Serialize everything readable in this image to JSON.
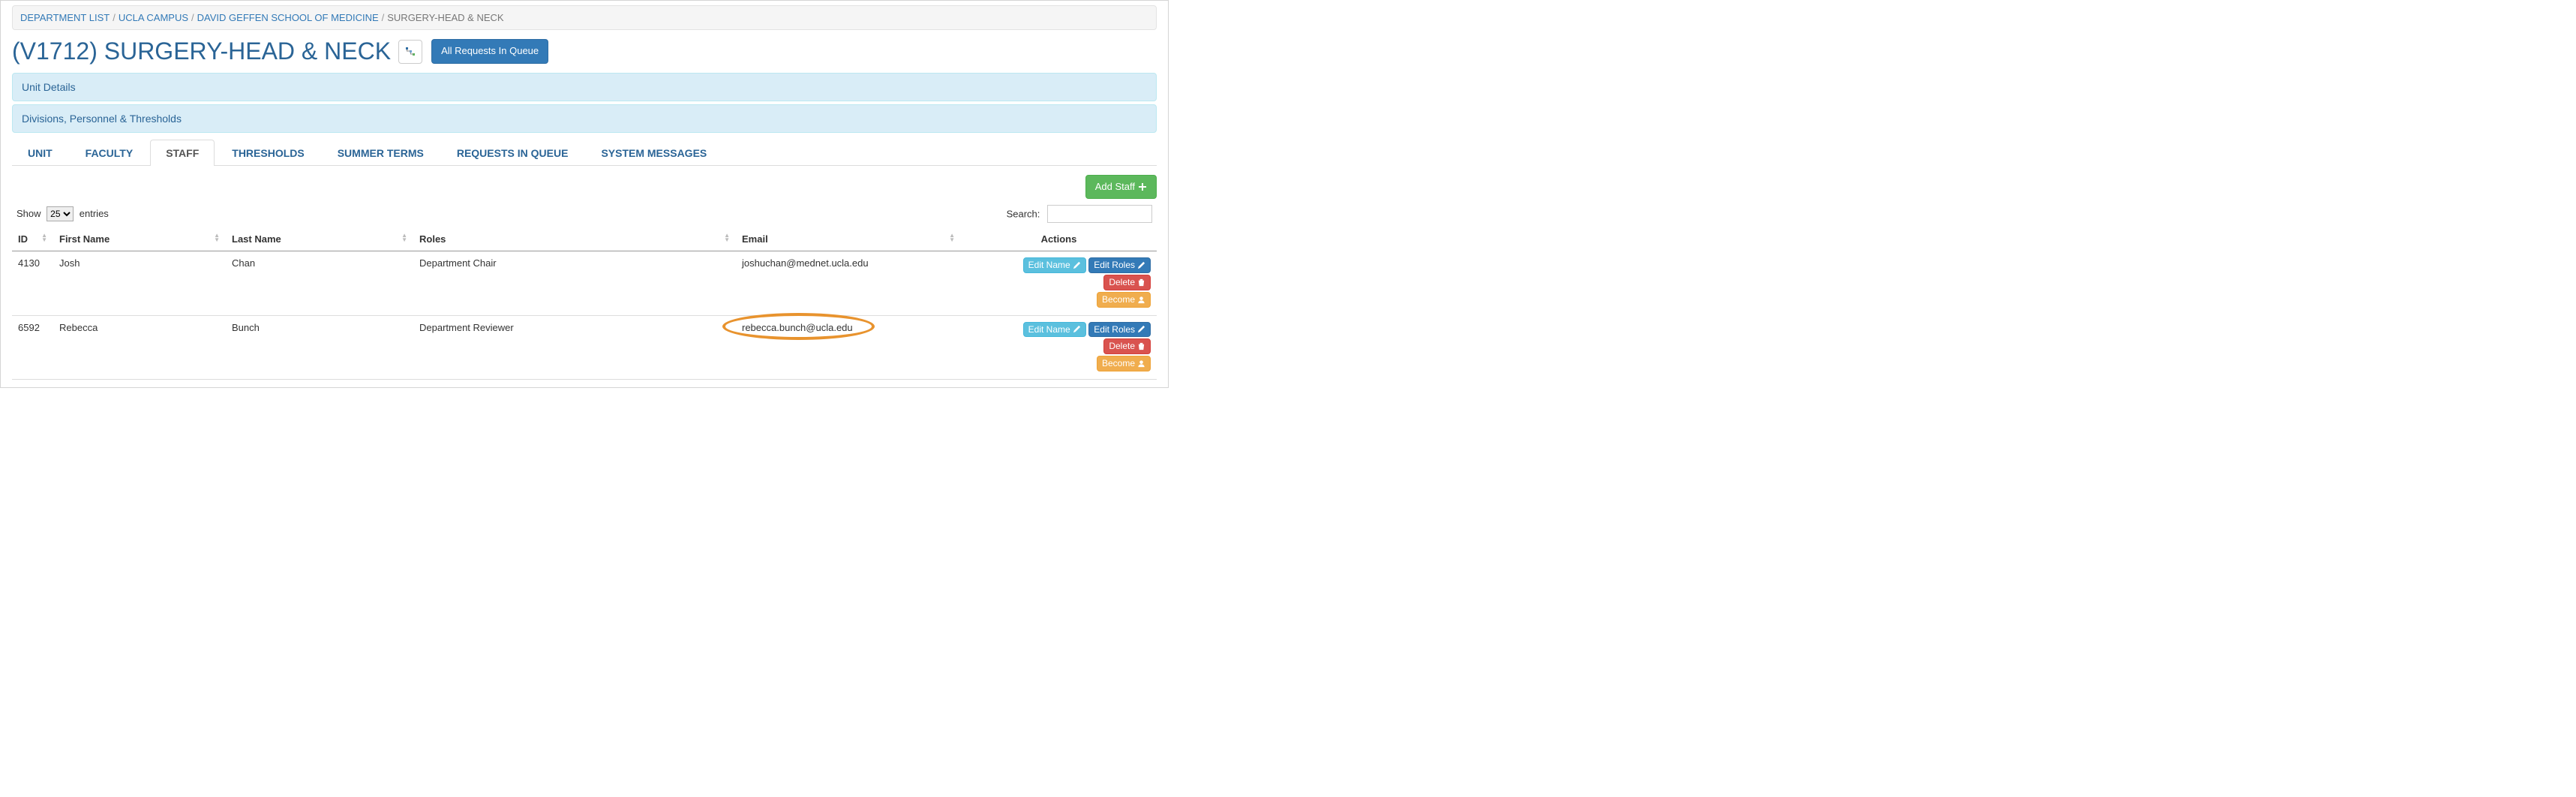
{
  "breadcrumb": {
    "items": [
      {
        "label": "DEPARTMENT LIST"
      },
      {
        "label": "UCLA CAMPUS"
      },
      {
        "label": "DAVID GEFFEN SCHOOL OF MEDICINE"
      }
    ],
    "current": "SURGERY-HEAD & NECK"
  },
  "title": "(V1712) SURGERY-HEAD & NECK",
  "all_requests_label": "All Requests In Queue",
  "panels": {
    "unit_details": "Unit Details",
    "divisions": "Divisions, Personnel & Thresholds"
  },
  "tabs": [
    {
      "label": "UNIT"
    },
    {
      "label": "FACULTY"
    },
    {
      "label": "STAFF",
      "active": true
    },
    {
      "label": "THRESHOLDS"
    },
    {
      "label": "SUMMER TERMS"
    },
    {
      "label": "REQUESTS IN QUEUE"
    },
    {
      "label": "SYSTEM MESSAGES"
    }
  ],
  "add_staff_label": "Add Staff",
  "length_menu": {
    "prefix": "Show",
    "suffix": "entries",
    "options": [
      "25"
    ]
  },
  "search_label": "Search:",
  "columns": {
    "id": "ID",
    "first_name": "First Name",
    "last_name": "Last Name",
    "roles": "Roles",
    "email": "Email",
    "actions": "Actions"
  },
  "rows": [
    {
      "id": "4130",
      "first_name": "Josh",
      "last_name": "Chan",
      "roles": "Department Chair",
      "email": "joshuchan@mednet.ucla.edu"
    },
    {
      "id": "6592",
      "first_name": "Rebecca",
      "last_name": "Bunch",
      "roles": "Department Reviewer",
      "email": "rebecca.bunch@ucla.edu",
      "highlight_email": true
    }
  ],
  "action_labels": {
    "edit_name": "Edit Name",
    "edit_roles": "Edit Roles",
    "delete": "Delete",
    "become": "Become"
  }
}
